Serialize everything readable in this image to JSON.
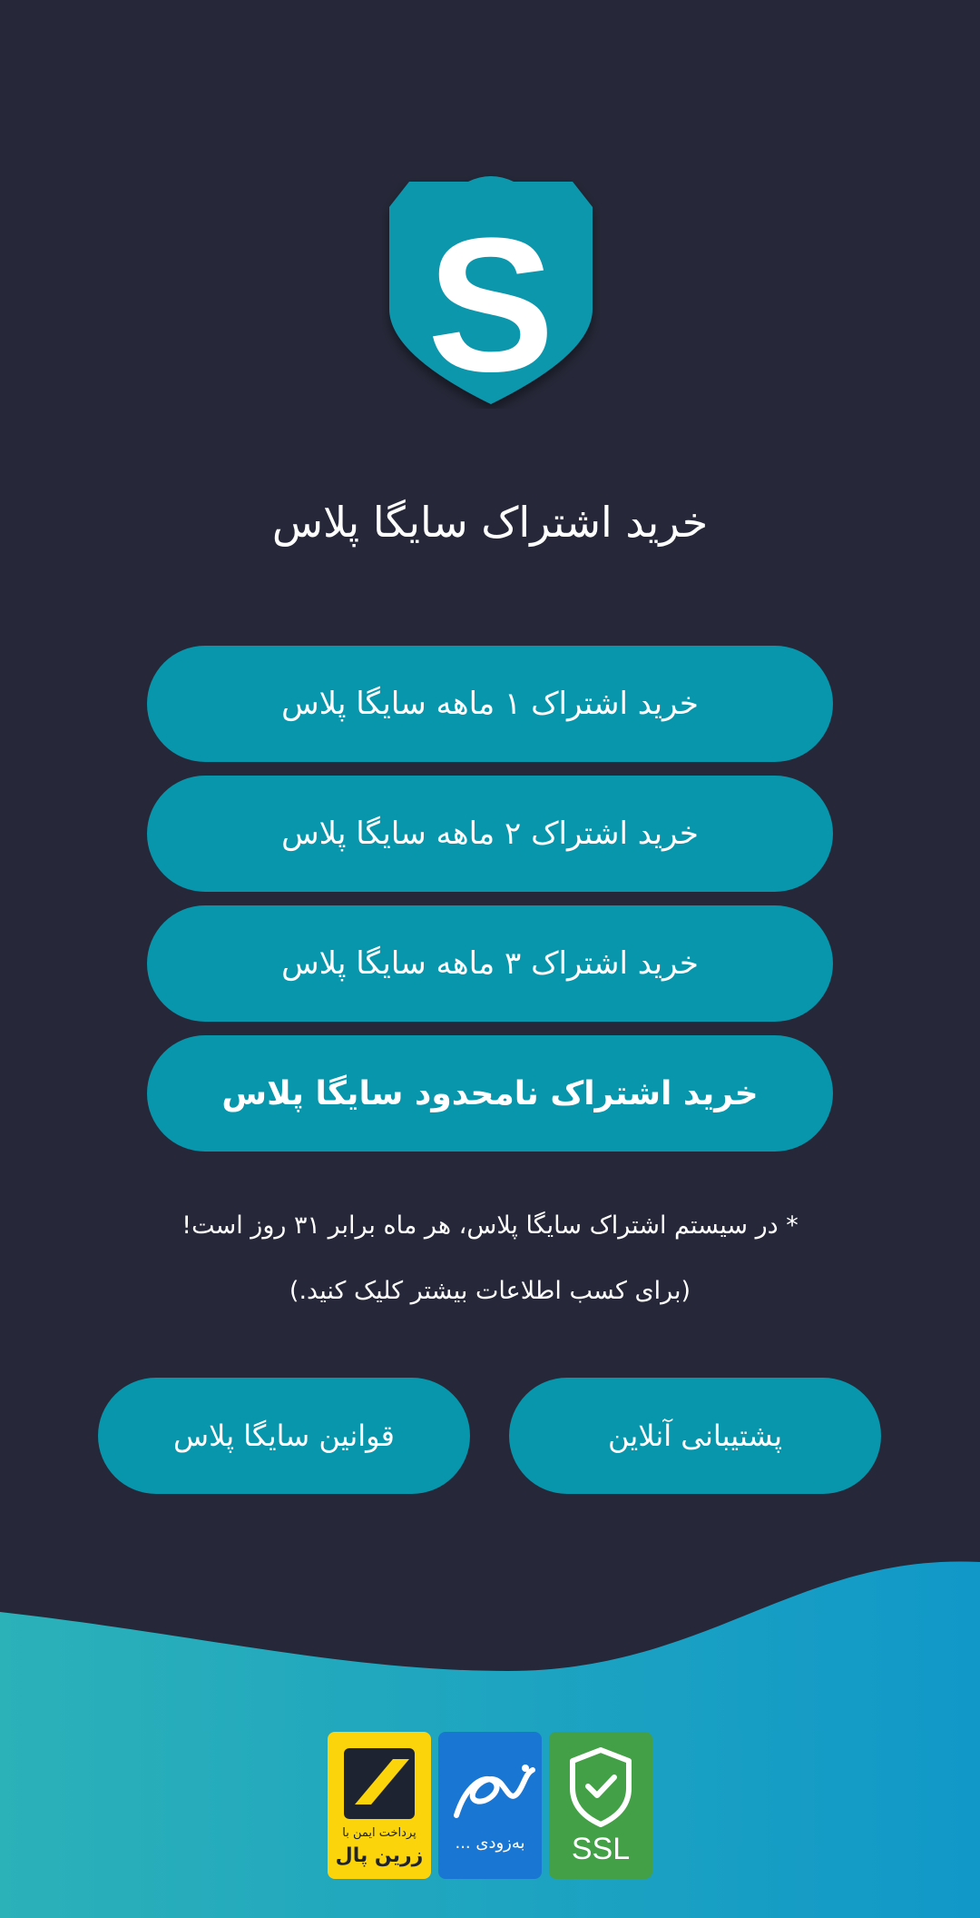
{
  "page": {
    "title": "خرید اشتراک سایگا پلاس"
  },
  "logo": {
    "letter": "S",
    "shield_color": "#0b97ad"
  },
  "plans": [
    {
      "label": "خرید اشتراک ۱ ماهه سایگا پلاس"
    },
    {
      "label": "خرید اشتراک ۲ ماهه سایگا پلاس"
    },
    {
      "label": "خرید اشتراک ۳ ماهه سایگا پلاس"
    },
    {
      "label": "خرید اشتراک نامحدود سایگا پلاس"
    }
  ],
  "notes": {
    "month_info": "* در سیستم اشتراک سایگا پلاس، هر ماه برابر ۳۱ روز است!",
    "more_info": "(برای کسب اطلاعات بیشتر کلیک کنید.)"
  },
  "actions": {
    "support": "پشتیبانی آنلاین",
    "rules": "قوانین سایگا پلاس"
  },
  "badges": {
    "zarinpal": {
      "line1": "پرداخت ایمن با",
      "line2": "زرین پال",
      "color": "#fcd40c"
    },
    "enamad": {
      "label": "به‌زودی ...",
      "color": "#1976d2"
    },
    "ssl": {
      "label": "SSL",
      "color": "#43a047"
    }
  },
  "colors": {
    "background": "#262839",
    "button": "#0796ab",
    "wave_start": "#2bb1b8",
    "wave_end": "#1198c8"
  }
}
